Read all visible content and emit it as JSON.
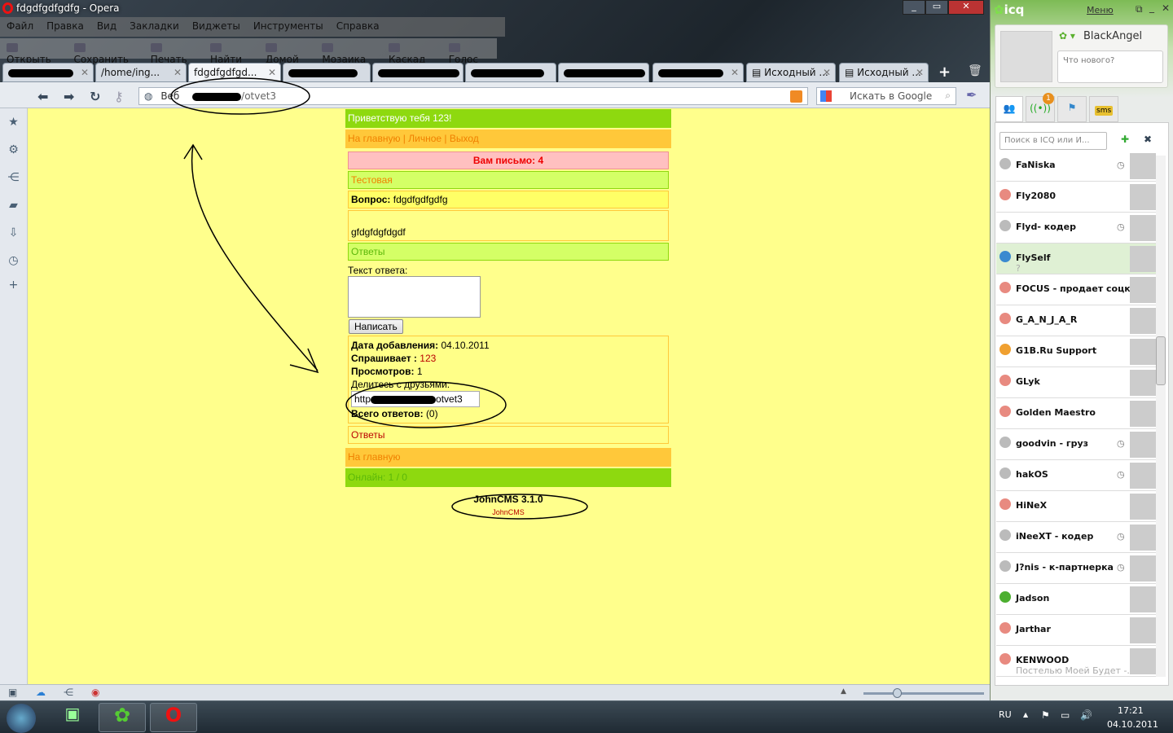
{
  "window": {
    "title": "fdgdfgdfgdfg - Opera",
    "controls": [
      "_",
      "▭",
      "✕"
    ]
  },
  "menu": [
    "Файл",
    "Правка",
    "Вид",
    "Закладки",
    "Виджеты",
    "Инструменты",
    "Справка"
  ],
  "toolbar": [
    "Открыть",
    "Сохранить",
    "Печать",
    "Найти",
    "Домой",
    "Мозаика",
    "Каскад",
    "Голос"
  ],
  "tabs": [
    {
      "label": "",
      "redacted": true
    },
    {
      "label": "/home/ing..."
    },
    {
      "label": "fdgdfgdfgd...",
      "active": true
    },
    {
      "label": "",
      "redacted": true
    },
    {
      "label": "",
      "redacted": true
    },
    {
      "label": "",
      "redacted": true
    },
    {
      "label": "",
      "redacted": true
    },
    {
      "label": "Исходный ..."
    },
    {
      "label": "Исходный ..."
    }
  ],
  "address": {
    "scope": "Веб",
    "url_suffix": "/otvet3",
    "search_placeholder": "Искать в Google"
  },
  "page": {
    "greeting": "Приветствую тебя 123!",
    "nav": [
      "На главную",
      "Личное",
      "Выход"
    ],
    "mail": "Вам письмо: 4",
    "category": "Тестовая",
    "question_label": "Вопрос:",
    "question": "fdgdfgdfgdfg",
    "body": "gfdgfdgfdgdf",
    "answers_header": "Ответы",
    "answer_label": "Текст ответа:",
    "submit": "Написать",
    "date_label": "Дата добавления:",
    "date": "04.10.2011",
    "asker_label": "Спрашивает :",
    "asker": "123",
    "views_label": "Просмотров:",
    "views": "1",
    "share_label": "Делитесь с друзьями:",
    "share_url_prefix": "http",
    "share_url_suffix": "otvet3",
    "total_label": "Всего ответов:",
    "total": "(0)",
    "answers_link": "Ответы",
    "home": "На главную",
    "online": "Онлайн: 1 / 0",
    "cms": "JohnCMS 3.1.0",
    "cms_link": "JohnCMS"
  },
  "icq": {
    "logo": "icq",
    "menu": "Меню",
    "user": "BlackAngel",
    "status_placeholder": "Что нового?",
    "badge": "1",
    "sms": "sms",
    "search_placeholder": "Поиск в ICQ или И...",
    "contacts": [
      {
        "name": "FaNiska",
        "status": "offline",
        "away": true
      },
      {
        "name": "Fly2080",
        "status": "online"
      },
      {
        "name": "Flyd- кодер",
        "status": "offline",
        "away": true
      },
      {
        "name": "FlySelf",
        "status": "custom",
        "sub": "?",
        "selected": true
      },
      {
        "name": "FOCUS - продает соцк",
        "status": "online"
      },
      {
        "name": "G_A_N_J_A_R",
        "status": "online"
      },
      {
        "name": "G1B.Ru Support",
        "status": "sleep"
      },
      {
        "name": "GLyk",
        "status": "online"
      },
      {
        "name": "Golden Maestro",
        "status": "online"
      },
      {
        "name": "goodvin - груз",
        "status": "offline",
        "away": true
      },
      {
        "name": "hakOS",
        "status": "offline",
        "away": true
      },
      {
        "name": "HiNeX",
        "status": "online"
      },
      {
        "name": "iNeeXT - кодер",
        "status": "offline",
        "away": true
      },
      {
        "name": "J?nis - к-партнерка",
        "status": "offline",
        "away": true
      },
      {
        "name": "Jadson",
        "status": "dnd"
      },
      {
        "name": "Jarthar",
        "status": "online"
      },
      {
        "name": "KENWOOD",
        "status": "online",
        "sub": "Постелью Моей Будет -..."
      }
    ]
  },
  "taskbar": {
    "lang": "RU",
    "time": "17:21",
    "date": "04.10.2011"
  },
  "colors": {
    "page_bg": "#ffff8c",
    "green": "#8ed90f",
    "orange": "#ffc83a",
    "light_green": "#d4ff66",
    "pink": "#ffc0c0"
  }
}
